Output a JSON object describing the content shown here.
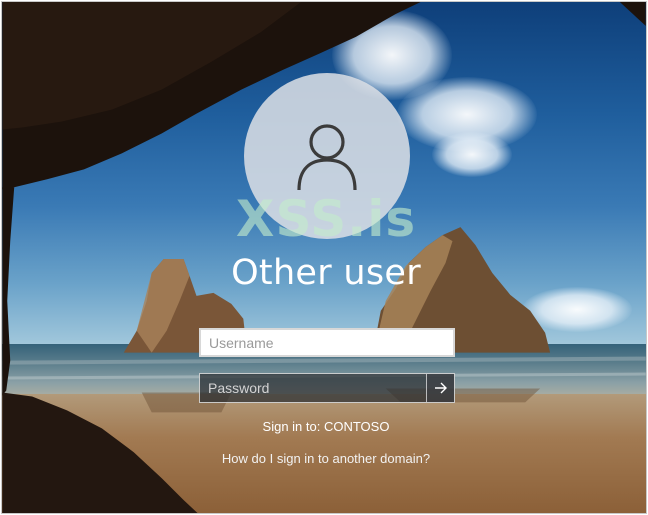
{
  "watermark": "XSS.is",
  "user": {
    "name": "Other user",
    "avatar_icon": "user-icon"
  },
  "form": {
    "username_placeholder": "Username",
    "username_value": "",
    "password_placeholder": "Password",
    "password_value": "",
    "submit_icon": "arrow-right-icon"
  },
  "sign_in_to": "Sign in to: CONTOSO",
  "help_link": "How do I sign in to another domain?",
  "colors": {
    "text": "#ffffff",
    "input_bg": "#ffffff",
    "password_bg": "#282c30",
    "avatar_bg": "#dce0e5"
  }
}
